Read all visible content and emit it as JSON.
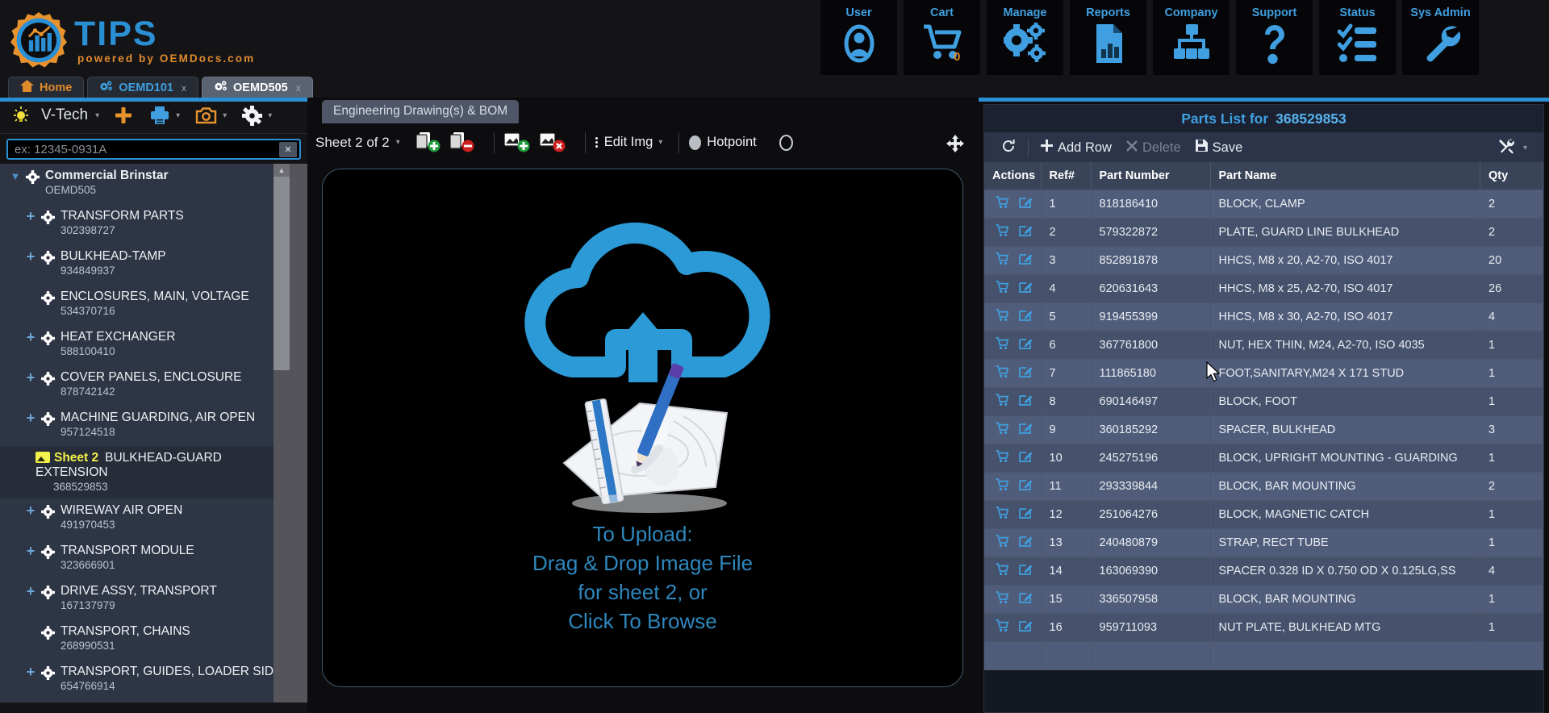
{
  "brand": {
    "title": "TIPS",
    "subtitle": "powered by OEMDocs.com"
  },
  "topnav": [
    {
      "label": "User",
      "icon": "user-icon"
    },
    {
      "label": "Cart",
      "icon": "cart-icon",
      "badge": "0"
    },
    {
      "label": "Manage",
      "icon": "gears-icon"
    },
    {
      "label": "Reports",
      "icon": "report-chart-icon"
    },
    {
      "label": "Company",
      "icon": "org-chart-icon"
    },
    {
      "label": "Support",
      "icon": "question-mark-icon"
    },
    {
      "label": "Status",
      "icon": "checklist-icon"
    },
    {
      "label": "Sys Admin",
      "icon": "wrench-icon"
    }
  ],
  "tabs": [
    {
      "label": "Home",
      "icon": "home-icon",
      "closable": false,
      "active": false
    },
    {
      "label": "OEMD101",
      "icon": "gears-icon",
      "closable": true,
      "close": "x",
      "active": false
    },
    {
      "label": "OEMD505",
      "icon": "gears-icon",
      "closable": true,
      "close": "x",
      "active": true
    }
  ],
  "left_toolbar": {
    "lightbulb_icon": "lightbulb-icon",
    "vtech_label": "V-Tech",
    "caret": "▾",
    "add_icon": "plus-icon",
    "print_icon": "printer-icon",
    "camera_icon": "camera-icon",
    "settings_icon": "gear-icon"
  },
  "search": {
    "value": "",
    "placeholder": "ex: 12345-0931A",
    "clear_icon": "clear-x-icon"
  },
  "tree": [
    {
      "level": "root",
      "expander": "chevron-down-icon",
      "name": "Commercial Brinstar",
      "number": "OEMD505",
      "selected": false
    },
    {
      "level": "lvl1",
      "expander": "plus-icon",
      "name": "TRANSFORM PARTS",
      "number": "302398727",
      "selected": false
    },
    {
      "level": "lvl1",
      "expander": "plus-icon",
      "name": "BULKHEAD-TAMP",
      "number": "934849937",
      "selected": false
    },
    {
      "level": "lvl1",
      "expander": "none",
      "name": "ENCLOSURES, MAIN, VOLTAGE",
      "number": "534370716",
      "selected": false
    },
    {
      "level": "lvl1",
      "expander": "plus-icon",
      "name": "HEAT EXCHANGER",
      "number": "588100410",
      "selected": false
    },
    {
      "level": "lvl1",
      "expander": "plus-icon",
      "name": "COVER PANELS, ENCLOSURE",
      "number": "878742142",
      "selected": false
    },
    {
      "level": "lvl1",
      "expander": "plus-icon",
      "name": "MACHINE GUARDING, AIR OPEN",
      "number": "957124518",
      "selected": false
    },
    {
      "level": "sheet",
      "expander": "none",
      "sheet_label": "Sheet 2",
      "name": "BULKHEAD-GUARD EXTENSION",
      "number": "368529853",
      "selected": true
    },
    {
      "level": "lvl1",
      "expander": "plus-icon",
      "name": "WIREWAY AIR OPEN",
      "number": "491970453",
      "selected": false
    },
    {
      "level": "lvl1",
      "expander": "plus-icon",
      "name": "TRANSPORT MODULE",
      "number": "323666901",
      "selected": false
    },
    {
      "level": "lvl1",
      "expander": "plus-icon",
      "name": "DRIVE ASSY, TRANSPORT",
      "number": "167137979",
      "selected": false
    },
    {
      "level": "lvl1",
      "expander": "none",
      "name": "TRANSPORT, CHAINS",
      "number": "268990531",
      "selected": false
    },
    {
      "level": "lvl1",
      "expander": "plus-icon",
      "name": "TRANSPORT, GUIDES, LOADER SIDE",
      "number": "654766914",
      "selected": false
    }
  ],
  "center": {
    "tab_label": "Engineering Drawing(s) & BOM",
    "sheet_selector": "Sheet 2 of 2",
    "sheet_caret": "▾",
    "add_sheet_icon": "copy-add-icon",
    "remove_sheet_icon": "copy-remove-icon",
    "add_image_icon": "image-add-icon",
    "remove_image_icon": "image-remove-icon",
    "edit_img_label": "Edit Img",
    "edit_img_caret": "▾",
    "hotpoint_label": "Hotpoint",
    "hotpoint_filled_icon": "filled-circle-icon",
    "hotpoint_outline_icon": "outline-circle-icon",
    "move_icon": "move-arrows-icon",
    "upload": {
      "line1": "To Upload:",
      "line2": "Drag & Drop Image File",
      "line3": "for sheet 2, or",
      "line4": "Click To Browse",
      "art_icon": "cloud-upload-drawing-icon"
    }
  },
  "parts_panel": {
    "title_prefix": "Parts List for",
    "title_number": "368529853",
    "toolbar": {
      "refresh_icon": "refresh-icon",
      "add_row_label": "Add Row",
      "add_row_icon": "plus-icon",
      "delete_label": "Delete",
      "delete_icon": "x-icon",
      "save_label": "Save",
      "save_icon": "save-disk-icon",
      "tools_icon": "tools-icon",
      "tools_caret": "▾"
    },
    "columns": [
      "Actions",
      "Ref#",
      "Part Number",
      "Part Name",
      "Qty"
    ],
    "row_icons": {
      "cart": "add-to-cart-icon",
      "edit": "edit-pencil-icon"
    },
    "rows": [
      {
        "ref": "1",
        "part_number": "818186410",
        "part_name": "BLOCK, CLAMP",
        "qty": "2"
      },
      {
        "ref": "2",
        "part_number": "579322872",
        "part_name": "PLATE, GUARD LINE BULKHEAD",
        "qty": "2"
      },
      {
        "ref": "3",
        "part_number": "852891878",
        "part_name": "HHCS, M8 x 20, A2-70, ISO 4017",
        "qty": "20"
      },
      {
        "ref": "4",
        "part_number": "620631643",
        "part_name": "HHCS, M8 x 25, A2-70, ISO 4017",
        "qty": "26"
      },
      {
        "ref": "5",
        "part_number": "919455399",
        "part_name": "HHCS, M8 x 30, A2-70, ISO 4017",
        "qty": "4"
      },
      {
        "ref": "6",
        "part_number": "367761800",
        "part_name": "NUT, HEX THIN, M24, A2-70, ISO 4035",
        "qty": "1"
      },
      {
        "ref": "7",
        "part_number": "111865180",
        "part_name": "FOOT,SANITARY,M24 X 171 STUD",
        "qty": "1"
      },
      {
        "ref": "8",
        "part_number": "690146497",
        "part_name": "BLOCK, FOOT",
        "qty": "1"
      },
      {
        "ref": "9",
        "part_number": "360185292",
        "part_name": "SPACER, BULKHEAD",
        "qty": "3"
      },
      {
        "ref": "10",
        "part_number": "245275196",
        "part_name": "BLOCK, UPRIGHT MOUNTING - GUARDING",
        "qty": "1"
      },
      {
        "ref": "11",
        "part_number": "293339844",
        "part_name": "BLOCK, BAR MOUNTING",
        "qty": "2"
      },
      {
        "ref": "12",
        "part_number": "251064276",
        "part_name": "BLOCK, MAGNETIC CATCH",
        "qty": "1"
      },
      {
        "ref": "13",
        "part_number": "240480879",
        "part_name": "STRAP, RECT TUBE",
        "qty": "1"
      },
      {
        "ref": "14",
        "part_number": "163069390",
        "part_name": "SPACER 0.328 ID X 0.750 OD X 0.125LG,SS",
        "qty": "4"
      },
      {
        "ref": "15",
        "part_number": "336507958",
        "part_name": "BLOCK, BAR MOUNTING",
        "qty": "1"
      },
      {
        "ref": "16",
        "part_number": "959711093",
        "part_name": "NUT PLATE, BULKHEAD MTG",
        "qty": "1"
      }
    ]
  },
  "colors": {
    "accent_blue": "#3f9fe0",
    "accent_orange": "#e08a2e",
    "tree_bg": "#2e3544",
    "row_odd": "#505d7a",
    "row_even": "#46526c",
    "sheet_yellow": "#f2f24a"
  }
}
